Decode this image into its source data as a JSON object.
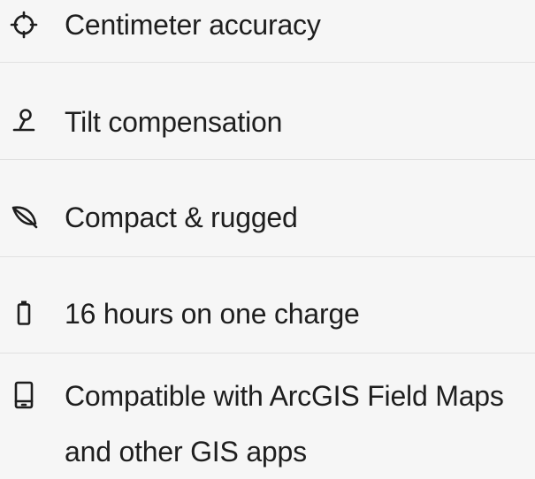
{
  "features": [
    {
      "icon": "crosshair-icon",
      "label": "Centimeter accuracy"
    },
    {
      "icon": "tilt-pole-icon",
      "label": "Tilt compensation"
    },
    {
      "icon": "leaf-icon",
      "label": "Compact & rugged"
    },
    {
      "icon": "battery-icon",
      "label": "16 hours on one charge"
    },
    {
      "icon": "mobile-phone-icon",
      "label_line1": "Compatible with ArcGIS Field Maps",
      "label_line2": "and other GIS apps"
    }
  ],
  "colors": {
    "background": "#f6f6f6",
    "text": "#1e1e1e",
    "divider": "#e1e1e1"
  }
}
